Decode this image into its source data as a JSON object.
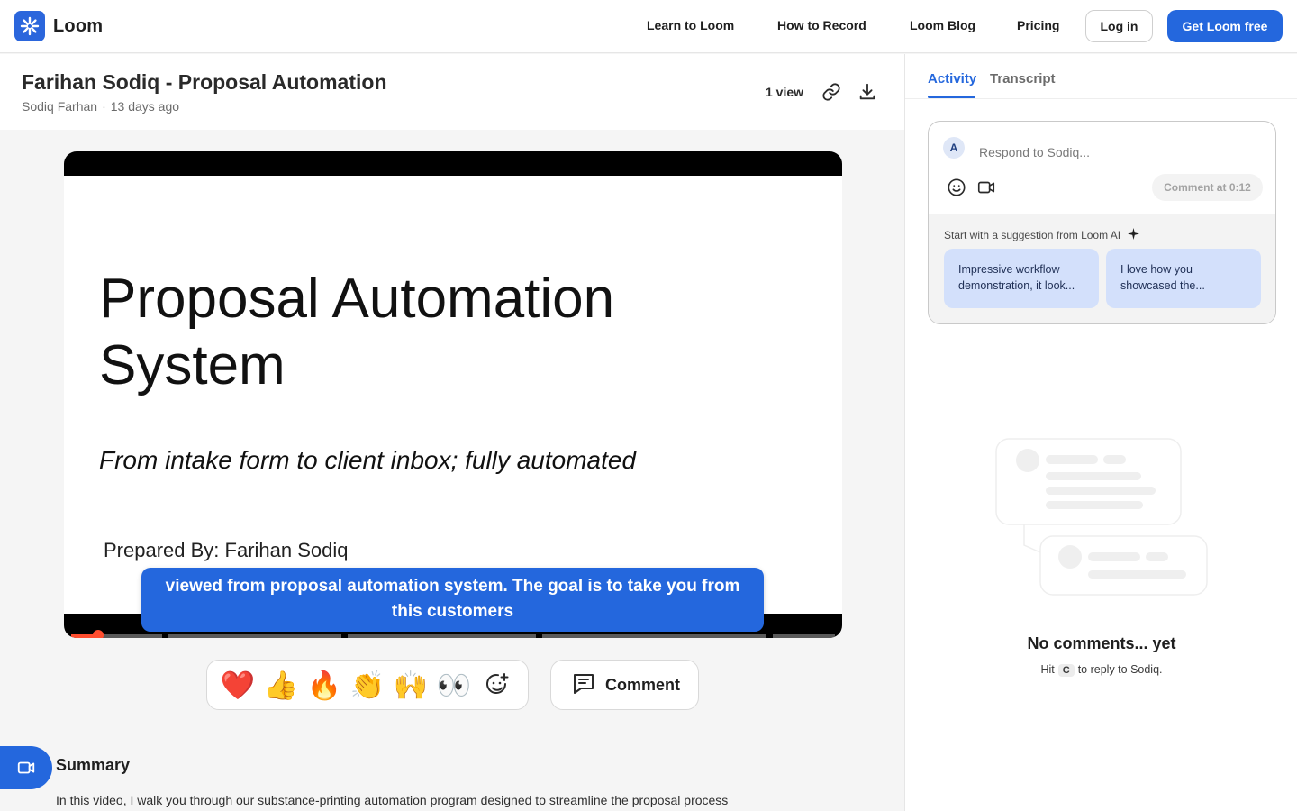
{
  "nav": {
    "brand": "Loom",
    "links": [
      "Learn to Loom",
      "How to Record",
      "Loom Blog",
      "Pricing"
    ],
    "login": "Log in",
    "signup": "Get Loom free"
  },
  "video": {
    "title": "Farihan Sodiq - Proposal Automation",
    "author": "Sodiq Farhan",
    "age": "13 days ago",
    "views": "1 view",
    "slide_title_line1": "Proposal Automation",
    "slide_title_line2": "System",
    "slide_subtitle": "From intake form to client inbox; fully automated",
    "slide_prepared": "Prepared By: Farihan Sodiq",
    "caption_line1": "viewed from proposal automation system. The goal is to take you from",
    "caption_line2": "this customers",
    "progress_fraction": 0.035
  },
  "reactions": [
    "❤️",
    "👍",
    "🔥",
    "👏",
    "🙌",
    "👀"
  ],
  "comment_button": "Comment",
  "summary": {
    "heading": "Summary",
    "text": "In this video, I walk you through our substance-printing automation program designed to streamline the proposal process"
  },
  "sidebar": {
    "tabs": [
      "Activity",
      "Transcript"
    ],
    "avatar_initial": "A",
    "input_placeholder": "Respond to Sodiq...",
    "comment_at": "Comment at 0:12",
    "ai_label": "Start with a suggestion from Loom AI",
    "suggestions": [
      {
        "line1": "Impressive workflow",
        "line2": "demonstration, it look..."
      },
      {
        "line1": "I love how you",
        "line2": "showcased the..."
      }
    ],
    "empty_title": "No comments... yet",
    "hint_prefix": "Hit",
    "hint_key": "C",
    "hint_suffix": "to reply to Sodiq."
  },
  "colors": {
    "accent": "#2467dd",
    "progress": "#ff4d2e",
    "chip": "#d3e0fb"
  }
}
